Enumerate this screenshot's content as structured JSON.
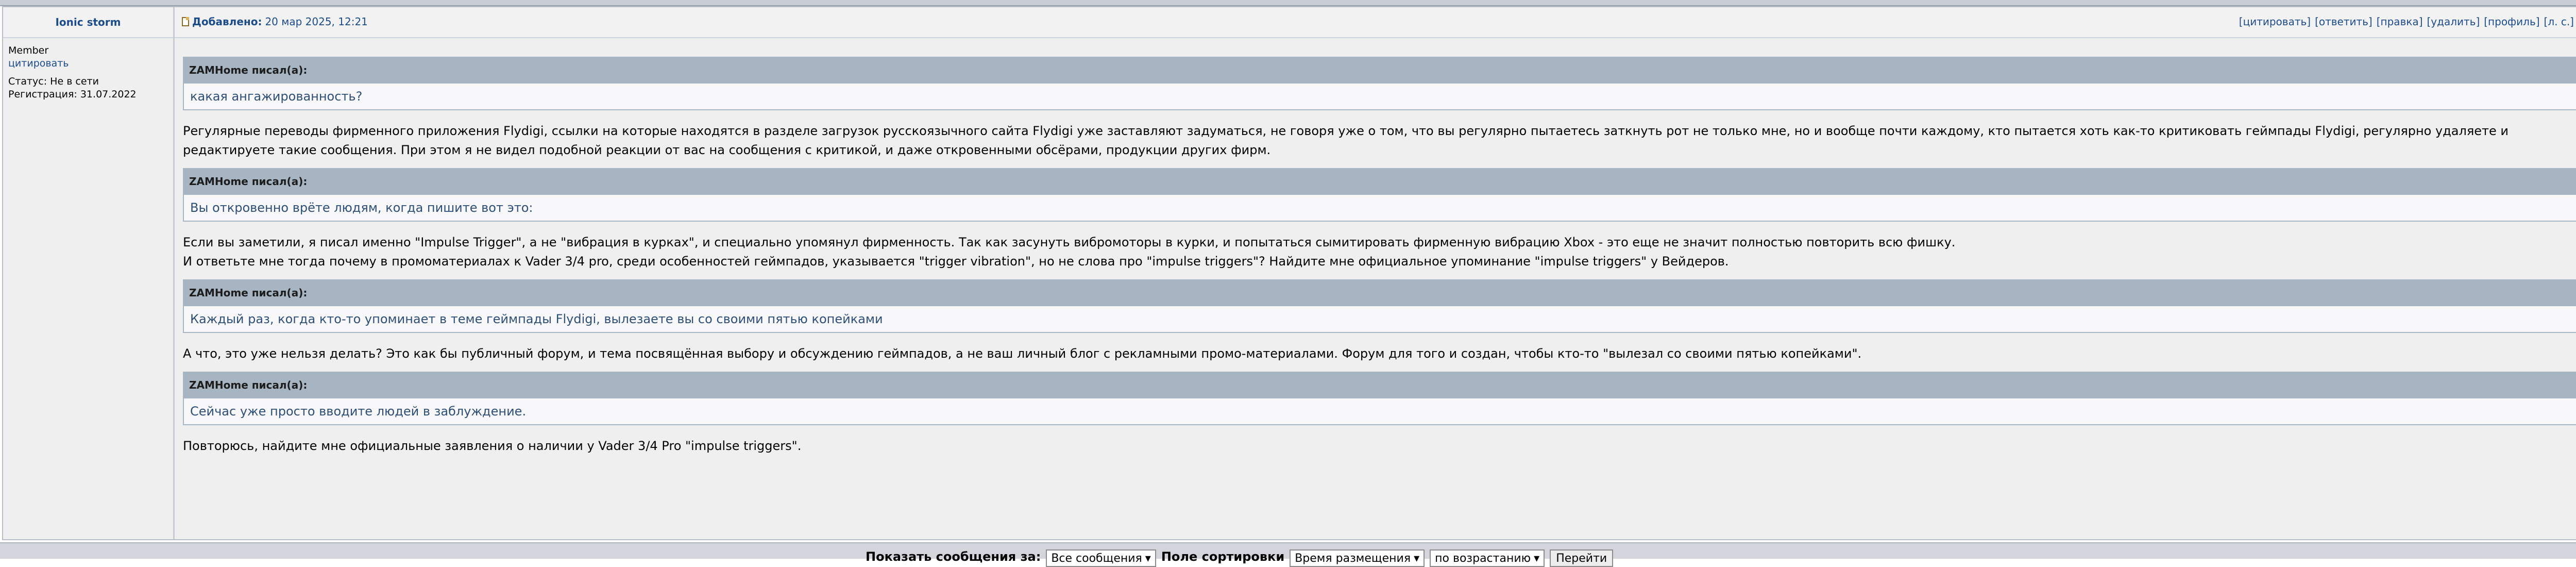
{
  "post": {
    "author": "Ionic storm",
    "rank": "Member",
    "quote_link": "цитировать",
    "status": "Статус: Не в сети",
    "registered": "Регистрация: 31.07.2022",
    "added_label": "Добавлено:",
    "added_date": "20 мар 2025, 12:21",
    "actions": [
      "[цитировать]",
      "[ответить]",
      "[правка]",
      "[удалить]",
      "[профиль]",
      "[л. с.]"
    ],
    "quote_author": "ZAMHome писал(а):",
    "quotes": [
      "какая ангажированность?",
      "Вы откровенно врёте людям, когда пишите вот это:",
      "Каждый раз, когда кто-то упоминает в теме геймпады Flydigi, вылезаете вы со своими пятью копейками",
      "Сейчас уже просто вводите людей в заблуждение."
    ],
    "paragraphs": [
      "Регулярные переводы фирменного приложения Flydigi, ссылки на которые находятся в разделе загрузок русскоязычного сайта Flydigi уже заставляют задуматься, не говоря уже о том, что вы регулярно пытаетесь заткнуть рот не только мне, но и вообще почти каждому, кто пытается хоть как-то критиковать геймпады Flydigi, регулярно удаляете и редактируете такие сообщения. При этом я не видел подобной реакции от вас на сообщения с критикой, и даже откровенными обсёрами, продукции других фирм.",
      "Если вы заметили, я писал именно \"Impulse Trigger\", а не \"вибрация в курках\", и специально упомянул фирменность. Так как засунуть вибромоторы в курки, и попытаться сымитировать фирменную вибрацию Xbox - это еще не значит полностью повторить всю фишку.\nИ ответьте мне тогда почему в промоматериалах к Vader 3/4 pro, среди особенностей геймпадов, указывается \"trigger vibration\", но не слова про \"impulse triggers\"? Найдите мне официальное упоминание \"impulse triggers\" у Вейдеров.",
      "А что, это уже нельзя делать? Это как бы публичный форум, и тема посвящённая выбору и обсуждению геймпадов, а не ваш личный блог с рекламными промо-материалами. Форум для того и создан, чтобы кто-то \"вылезал со своими пятью копейками\".",
      "Повторюсь, найдите мне официальные заявления о наличии у Vader 3/4 Pro \"impulse triggers\"."
    ]
  },
  "bottom": {
    "show_label": "Показать сообщения за:",
    "show_value": "Все сообщения",
    "sort_label": "Поле сортировки",
    "sort_value": "Время размещения",
    "order_value": "по возрастанию",
    "go_button": "Перейти"
  }
}
